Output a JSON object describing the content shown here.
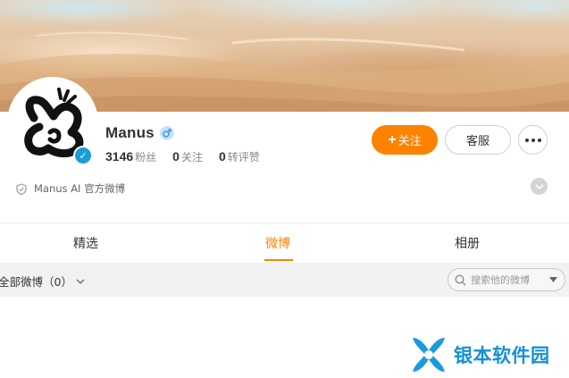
{
  "profile": {
    "name": "Manus",
    "stats": [
      {
        "value": "3146",
        "label": "粉丝"
      },
      {
        "value": "0",
        "label": "关注"
      },
      {
        "value": "0",
        "label": "转评赞"
      }
    ],
    "verification_text": "Manus AI 官方微博"
  },
  "actions": {
    "follow_plus": "+",
    "follow_label": "关注",
    "service_label": "客服"
  },
  "tabs": [
    {
      "label": "精选",
      "active": false
    },
    {
      "label": "微博",
      "active": true
    },
    {
      "label": "相册",
      "active": false
    }
  ],
  "filter": {
    "label": "全部微博（0）",
    "search_placeholder": "搜索他的微博"
  },
  "watermark": {
    "text": "银本软件园"
  },
  "colors": {
    "accent": "#ff8200",
    "verified": "#1d9bd8",
    "watermark": "#1590d8"
  },
  "icons": [
    "verified-icon",
    "male-icon",
    "more-icon",
    "shield-icon",
    "chevron-down-icon",
    "search-icon"
  ]
}
